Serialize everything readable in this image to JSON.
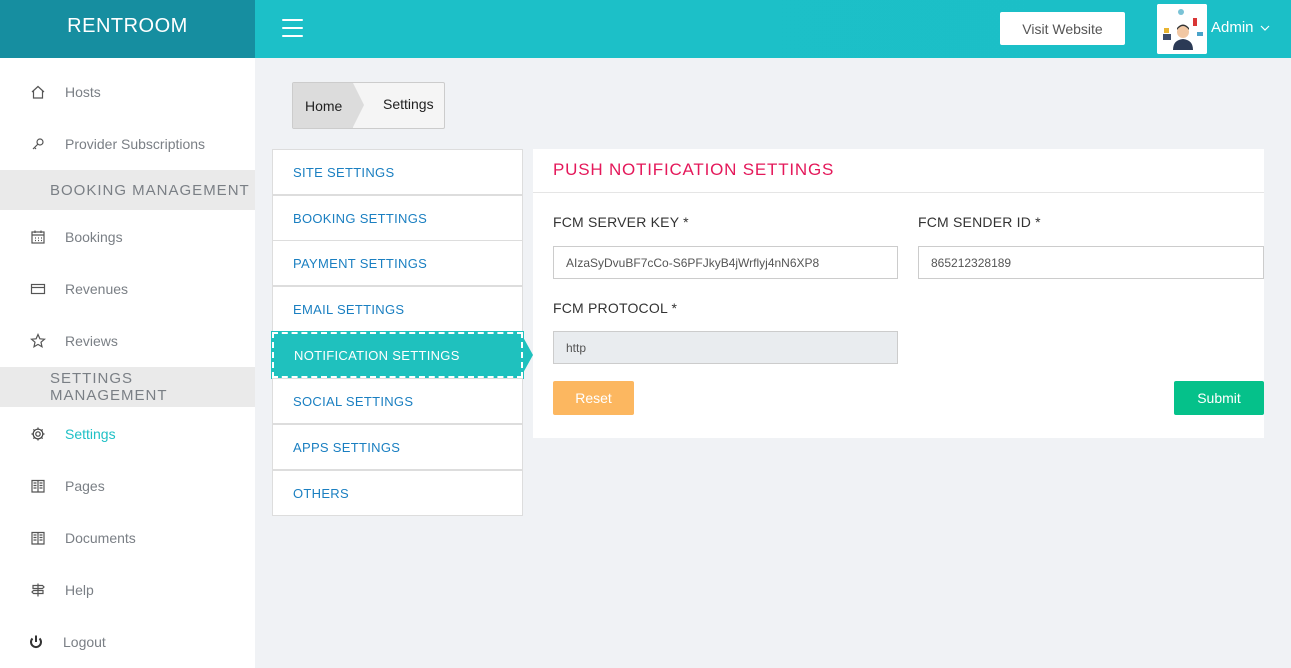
{
  "brand": "RENTROOM",
  "header": {
    "visit_label": "Visit Website",
    "user_name": "Admin"
  },
  "sidebar": {
    "items": [
      {
        "label": "Hosts",
        "icon": "home-icon"
      },
      {
        "label": "Provider Subscriptions",
        "icon": "key-icon"
      },
      {
        "label": "Bookings",
        "icon": "calendar-icon"
      },
      {
        "label": "Revenues",
        "icon": "credit-card-icon"
      },
      {
        "label": "Reviews",
        "icon": "star-icon"
      },
      {
        "label": "Settings",
        "icon": "gear-icon",
        "active": true
      },
      {
        "label": "Pages",
        "icon": "book-icon"
      },
      {
        "label": "Documents",
        "icon": "book-icon"
      },
      {
        "label": "Help",
        "icon": "signpost-icon"
      },
      {
        "label": "Logout",
        "icon": "power-icon"
      }
    ],
    "sections": [
      "BOOKING MANAGEMENT",
      "SETTINGS MANAGEMENT"
    ]
  },
  "breadcrumb": {
    "home": "Home",
    "current": "Settings"
  },
  "settings_menu": [
    {
      "label": "SITE SETTINGS"
    },
    {
      "label": "BOOKING SETTINGS"
    },
    {
      "label": "PAYMENT SETTINGS"
    },
    {
      "label": "EMAIL SETTINGS"
    },
    {
      "label": "NOTIFICATION SETTINGS",
      "active": true
    },
    {
      "label": "SOCIAL SETTINGS"
    },
    {
      "label": "APPS SETTINGS"
    },
    {
      "label": "OTHERS"
    }
  ],
  "panel": {
    "title": "PUSH NOTIFICATION SETTINGS",
    "fcm_server_key_label": "FCM SERVER KEY *",
    "fcm_server_key_value": "AIzaSyDvuBF7cCo-S6PFJkyB4jWrflyj4nN6XP8",
    "fcm_sender_id_label": "FCM SENDER ID *",
    "fcm_sender_id_value": "865212328189",
    "fcm_protocol_label": "FCM PROTOCOL *",
    "fcm_protocol_value": "http",
    "reset_label": "Reset",
    "submit_label": "Submit"
  },
  "colors": {
    "brand_bg": "#168ea0",
    "header_bg": "#1cc0c8",
    "accent": "#1fc0c6",
    "title_pink": "#e4185a",
    "reset_orange": "#fcb760",
    "submit_green": "#05c18a",
    "link_blue": "#1a7fc1"
  }
}
